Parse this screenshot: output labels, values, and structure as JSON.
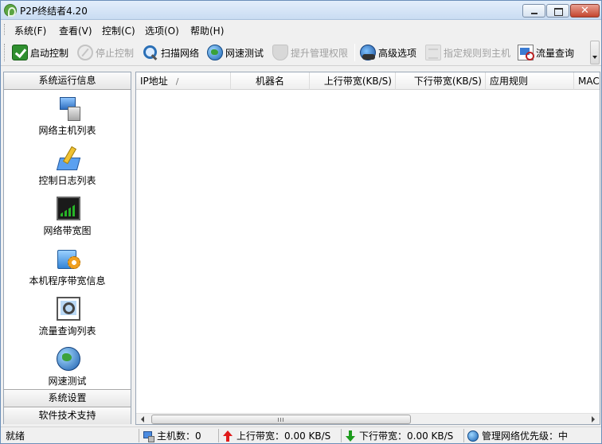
{
  "window": {
    "title": "P2P终结者4.20",
    "close_glyph": "✕"
  },
  "menu": {
    "items": [
      "系统(F)",
      "查看(V)",
      "控制(C)",
      "选项(O)",
      "帮助(H)"
    ]
  },
  "toolbar": {
    "start_control": "启动控制",
    "stop_control": "停止控制",
    "scan_network": "扫描网络",
    "speed_test": "网速测试",
    "elevate_privileges": "提升管理权限",
    "advanced_options": "高级选项",
    "assign_rule": "指定规则到主机",
    "traffic_query": "流量查询"
  },
  "left_panel": {
    "header": "系统运行信息",
    "items": [
      {
        "label": "网络主机列表",
        "icon": "network-hosts-icon"
      },
      {
        "label": "控制日志列表",
        "icon": "control-log-icon"
      },
      {
        "label": "网络带宽图",
        "icon": "bandwidth-chart-icon"
      },
      {
        "label": "本机程序带宽信息",
        "icon": "program-bandwidth-icon"
      },
      {
        "label": "流量查询列表",
        "icon": "traffic-query-icon"
      },
      {
        "label": "网速测试",
        "icon": "speed-test-icon"
      }
    ],
    "system_settings": "系统设置",
    "tech_support": "软件技术支持"
  },
  "list": {
    "columns": [
      "IP地址",
      "机器名",
      "上行带宽(KB/S)",
      "下行带宽(KB/S)",
      "应用规则",
      "MACH"
    ],
    "sort_indicator": "/",
    "rows": []
  },
  "status": {
    "ready": "就绪",
    "hosts": "主机数：0",
    "upload": "上行带宽：0.00 KB/S",
    "download": "下行带宽：0.00 KB/S",
    "priority": "管理网络优先级：中"
  }
}
